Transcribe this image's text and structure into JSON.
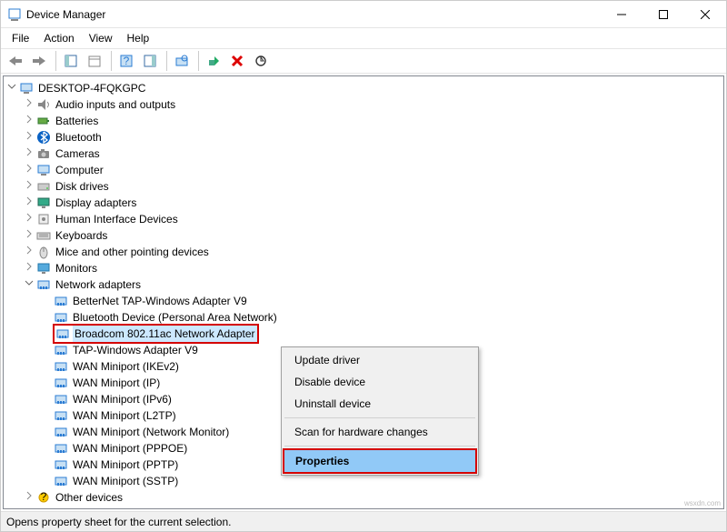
{
  "window": {
    "title": "Device Manager"
  },
  "menu": {
    "file": "File",
    "action": "Action",
    "view": "View",
    "help": "Help"
  },
  "tree": {
    "root": "DESKTOP-4FQKGPC",
    "categories": [
      {
        "label": "Audio inputs and outputs",
        "icon": "audio"
      },
      {
        "label": "Batteries",
        "icon": "battery"
      },
      {
        "label": "Bluetooth",
        "icon": "bluetooth"
      },
      {
        "label": "Cameras",
        "icon": "camera"
      },
      {
        "label": "Computer",
        "icon": "computer"
      },
      {
        "label": "Disk drives",
        "icon": "disk"
      },
      {
        "label": "Display adapters",
        "icon": "display"
      },
      {
        "label": "Human Interface Devices",
        "icon": "hid"
      },
      {
        "label": "Keyboards",
        "icon": "keyboard"
      },
      {
        "label": "Mice and other pointing devices",
        "icon": "mouse"
      },
      {
        "label": "Monitors",
        "icon": "monitor"
      }
    ],
    "networkAdapters": {
      "label": "Network adapters",
      "children": [
        "BetterNet TAP-Windows Adapter V9",
        "Bluetooth Device (Personal Area Network)",
        "Broadcom 802.11ac Network Adapter",
        "TAP-Windows Adapter V9",
        "WAN Miniport (IKEv2)",
        "WAN Miniport (IP)",
        "WAN Miniport (IPv6)",
        "WAN Miniport (L2TP)",
        "WAN Miniport (Network Monitor)",
        "WAN Miniport (PPPOE)",
        "WAN Miniport (PPTP)",
        "WAN Miniport (SSTP)"
      ],
      "selectedIndex": 2
    },
    "otherDevices": {
      "label": "Other devices"
    }
  },
  "contextMenu": {
    "items": [
      "Update driver",
      "Disable device",
      "Uninstall device",
      "Scan for hardware changes",
      "Properties"
    ],
    "selectedIndex": 4
  },
  "statusBar": "Opens property sheet for the current selection.",
  "watermark": "wsxdn.com"
}
